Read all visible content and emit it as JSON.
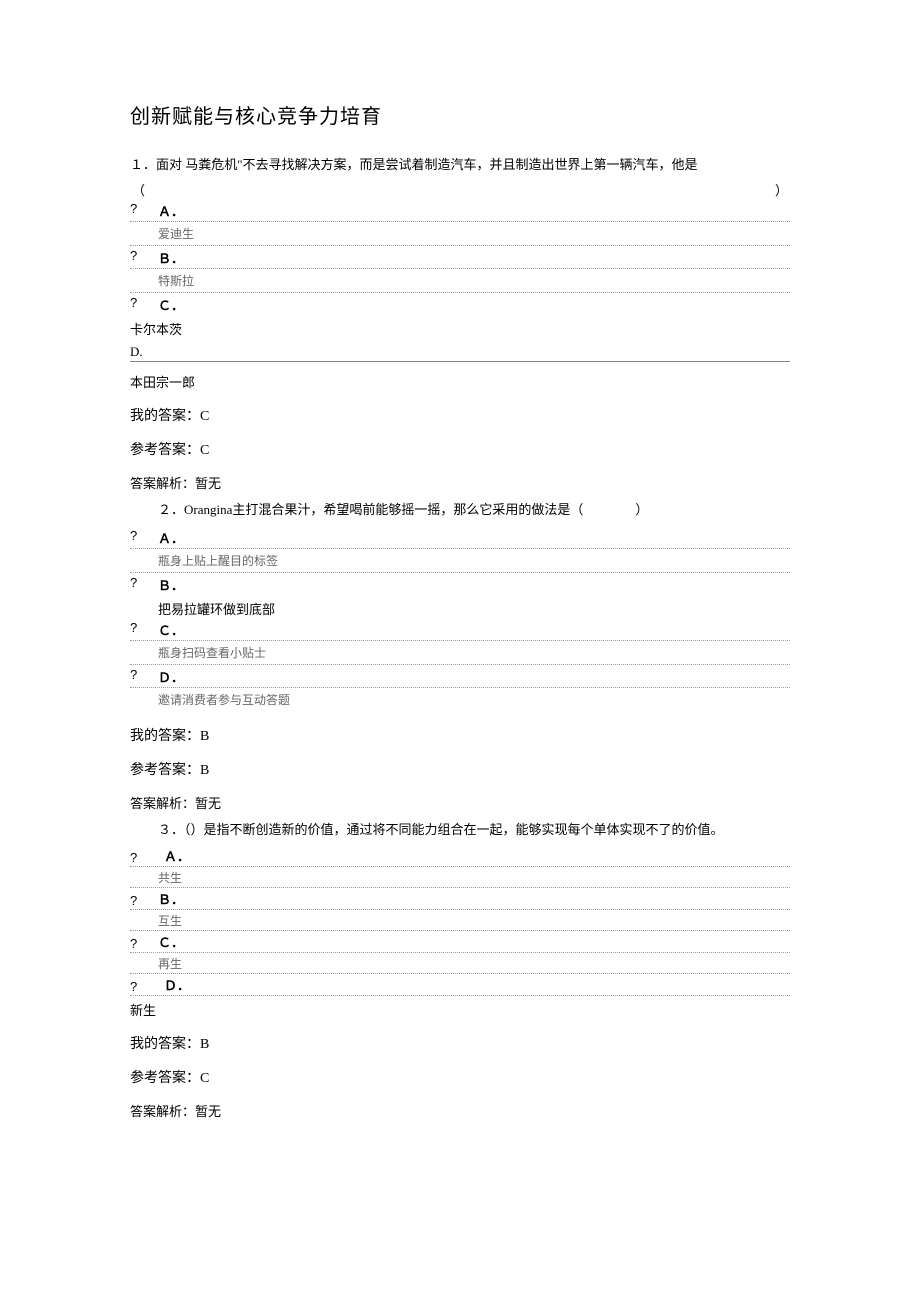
{
  "title": "创新赋能与核心竞争力培育",
  "q1": {
    "stem": "１．面对 马粪危机\"不去寻找解决方案，而是尝试着制造汽车，并且制造出世界上第一辆汽车，他是",
    "openParen": "（",
    "closeParen": "）",
    "optA": {
      "mark": "?",
      "letter": "Ａ．",
      "text": "爱迪生"
    },
    "optB": {
      "mark": "?",
      "letter": "Ｂ．",
      "text": "特斯拉"
    },
    "optC": {
      "mark": "?",
      "letter": "Ｃ．",
      "text": "卡尔本茨"
    },
    "optD": {
      "letter": "D.",
      "text": "本田宗一郎"
    },
    "my": "我的答案：C",
    "ref": "参考答案：C",
    "analysis": "答案解析：暂无"
  },
  "q2": {
    "stem": "２．Orangina主打混合果汁，希望喝前能够摇一摇，那么它采用的做法是（　　　　）",
    "optA": {
      "mark": "?",
      "letter": "Ａ．",
      "text": "瓶身上贴上醒目的标签"
    },
    "optB": {
      "mark": "?",
      "letter": "Ｂ．",
      "text": "把易拉罐环做到底部"
    },
    "optC": {
      "mark": "?",
      "letter": "Ｃ．",
      "text": "瓶身扫码查看小贴士"
    },
    "optD": {
      "mark": "?",
      "letter": "Ｄ．",
      "text": "邀请消费者参与互动答题"
    },
    "my": "我的答案：B",
    "ref": "参考答案：B",
    "analysis": "答案解析：暂无"
  },
  "q3": {
    "stem": "３．（）是指不断创造新的价值，通过将不同能力组合在一起，能够实现每个单体实现不了的价值。",
    "optA": {
      "mark": "?",
      "letter": "Ａ．",
      "text": "共生"
    },
    "optB": {
      "mark": "?",
      "letter": "Ｂ．",
      "text": "互生"
    },
    "optC": {
      "mark": "?",
      "letter": "Ｃ．",
      "text": "再生"
    },
    "optD": {
      "mark": "?",
      "letter": "Ｄ．",
      "text": "新生"
    },
    "my": "我的答案：B",
    "ref": "参考答案：C",
    "analysis": "答案解析：暂无"
  }
}
